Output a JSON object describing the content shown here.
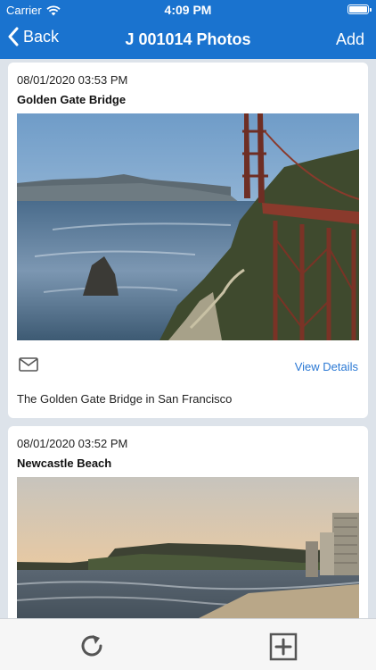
{
  "status_bar": {
    "carrier": "Carrier",
    "time": "4:09 PM"
  },
  "nav": {
    "back_label": "Back",
    "title": "J 001014 Photos",
    "add_label": "Add"
  },
  "photos": [
    {
      "date": "08/01/2020 03:53 PM",
      "title": "Golden Gate Bridge",
      "view_details_label": "View Details",
      "description": "The Golden Gate Bridge in San Francisco"
    },
    {
      "date": "08/01/2020 03:52 PM",
      "title": "Newcastle Beach"
    }
  ],
  "toolbar": {
    "refresh_icon": "refresh-icon",
    "add_icon": "plus-square-icon"
  },
  "colors": {
    "brand": "#1a73cf",
    "link": "#2a78d4",
    "background": "#dde3ea"
  }
}
